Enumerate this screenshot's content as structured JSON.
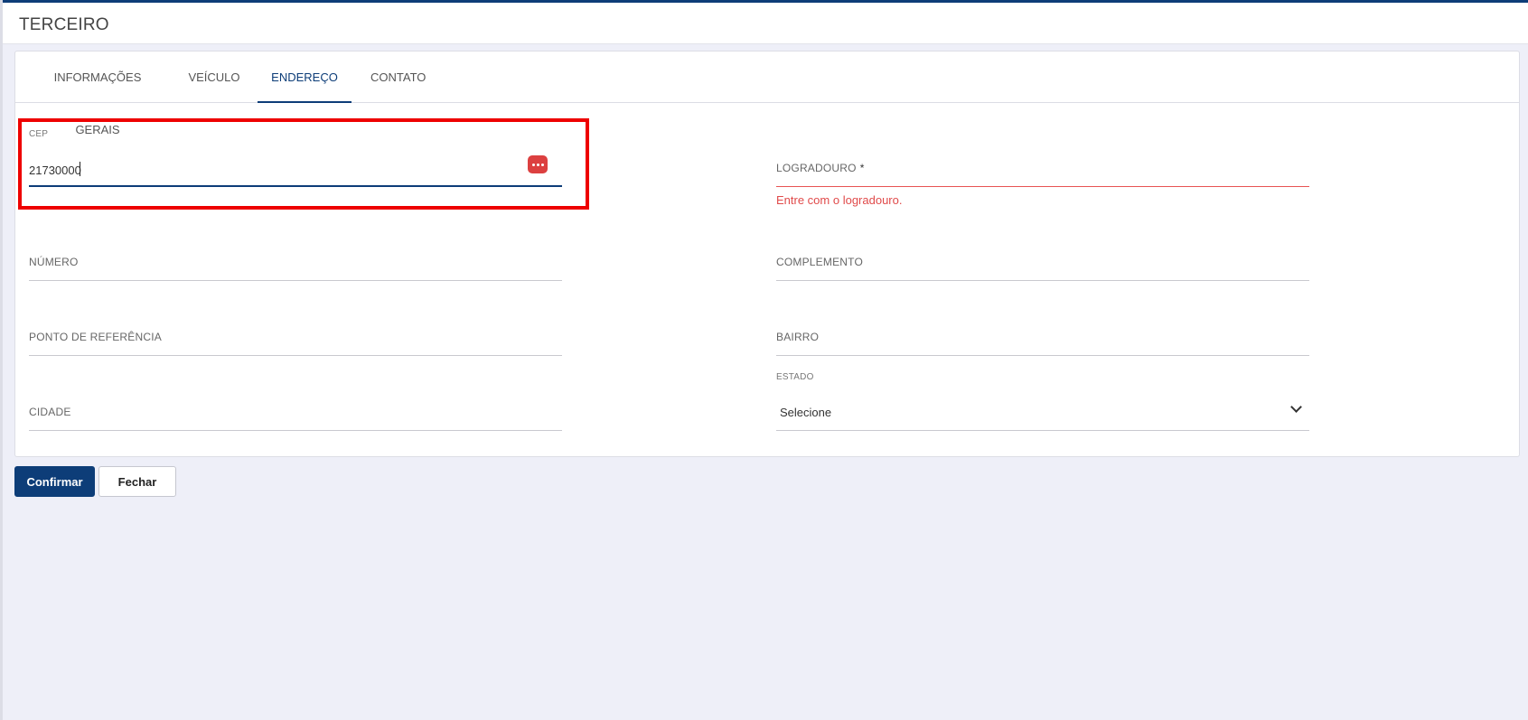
{
  "header": {
    "title": "TERCEIRO"
  },
  "tabs": [
    {
      "label": "INFORMAÇÕES GERAIS"
    },
    {
      "label": "VEÍCULO"
    },
    {
      "label": "ENDEREÇO",
      "active": true
    },
    {
      "label": "CONTATO"
    }
  ],
  "form": {
    "cep": {
      "label": "CEP",
      "value": "21730000"
    },
    "logradouro": {
      "label": "LOGRADOURO",
      "required_mark": "*",
      "error": "Entre com o logradouro."
    },
    "numero": {
      "label": "NÚMERO"
    },
    "complemento": {
      "label": "COMPLEMENTO"
    },
    "ponto_referencia": {
      "label": "PONTO DE REFERÊNCIA"
    },
    "bairro": {
      "label": "BAIRRO"
    },
    "cidade": {
      "label": "CIDADE"
    },
    "estado": {
      "label": "ESTADO",
      "selected": "Selecione"
    }
  },
  "buttons": {
    "confirm": "Confirmar",
    "close": "Fechar"
  },
  "colors": {
    "primary": "#0d3d78",
    "error": "#e04a4a",
    "highlight": "#ee0000",
    "background": "#eeeff8"
  },
  "icons": {
    "cep_field": "more-dots-icon",
    "estado_select": "chevron-down-icon"
  }
}
